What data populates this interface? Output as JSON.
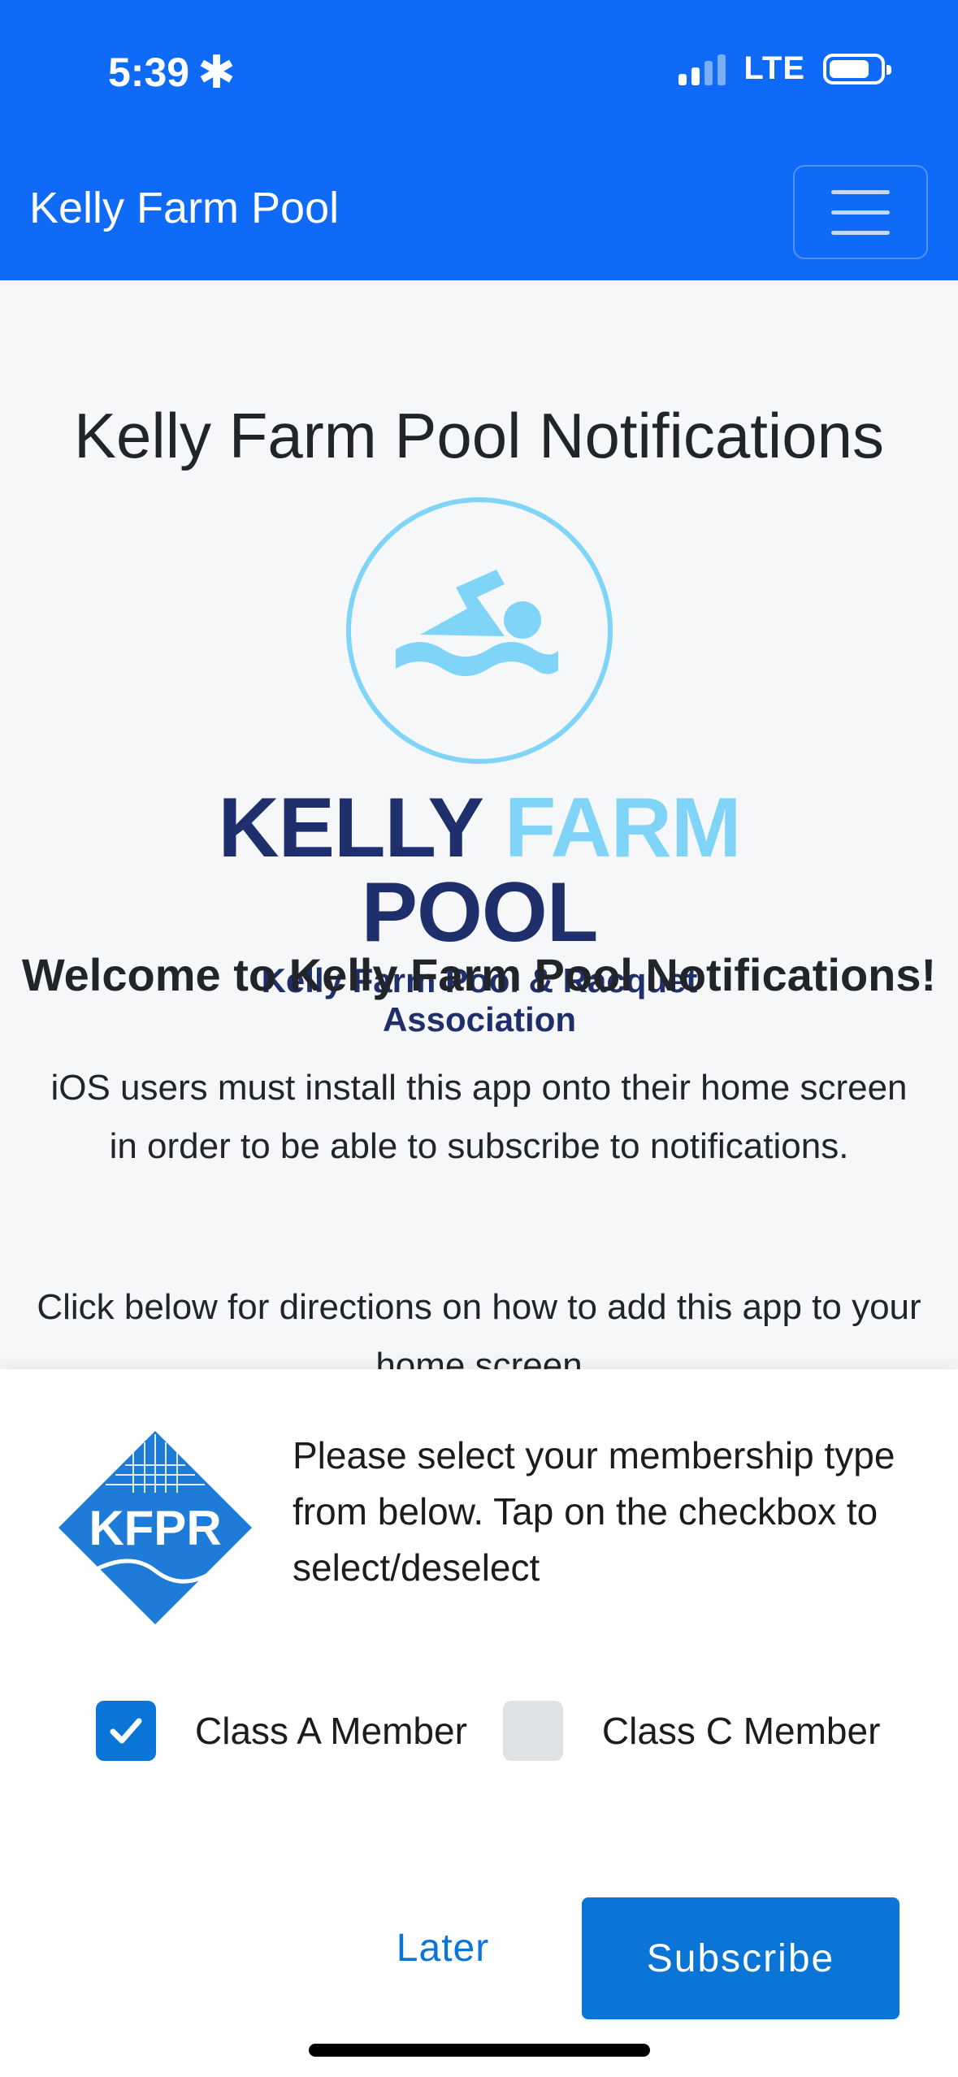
{
  "status_bar": {
    "time": "5:39",
    "network": "LTE"
  },
  "navbar": {
    "brand": "Kelly Farm Pool"
  },
  "main": {
    "title": "Kelly Farm Pool Notifications",
    "logo": {
      "name_part1": "KELLY",
      "name_part2": "FARM",
      "name_part3": "POOL",
      "tagline": "Kelly Farm Pool & Racquet Association"
    },
    "welcome": "Welcome to Kelly Farm Pool Notifications!",
    "ios_note": "iOS users must install this app onto their home screen in order to be able to subscribe to notifications.",
    "directions": "Click below for directions on how to add this app to your home screen"
  },
  "prompt": {
    "logo_text": "KFPR",
    "message": "Please select your membership type from below. Tap on the checkbox to select/deselect",
    "options": [
      {
        "label": "Class A Member",
        "checked": true
      },
      {
        "label": "Class C Member",
        "checked": false
      }
    ],
    "later_label": "Later",
    "subscribe_label": "Subscribe"
  },
  "colors": {
    "nav_blue": "#0f6af8",
    "button_blue": "#0a74d7",
    "logo_navy": "#1e2f6b",
    "logo_light_blue": "#7fd4f7"
  }
}
